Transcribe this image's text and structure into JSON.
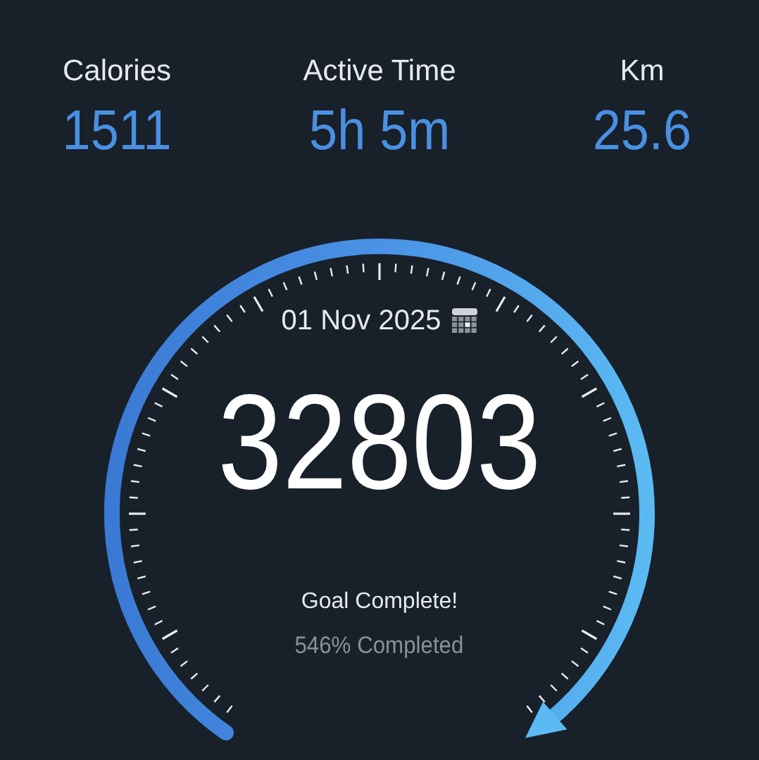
{
  "stats": [
    {
      "label": "Calories",
      "value": "1511"
    },
    {
      "label": "Active Time",
      "value": "5h 5m"
    },
    {
      "label": "Km",
      "value": "25.6"
    }
  ],
  "dial": {
    "date": "01 Nov 2025",
    "steps": "32803",
    "status": "Goal Complete!",
    "percent": "546% Completed"
  }
}
